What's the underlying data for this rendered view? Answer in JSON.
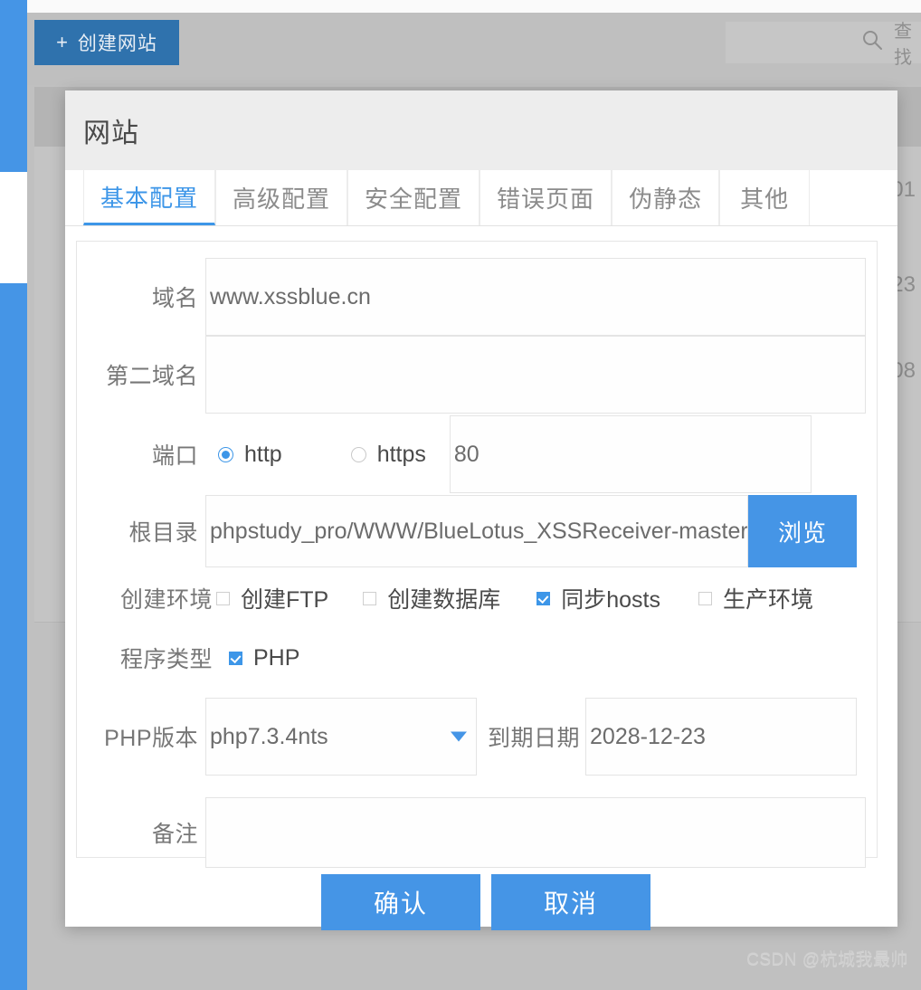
{
  "background": {
    "create_site_button": "创建网站",
    "create_site_plus": "+",
    "search_placeholder": "查找",
    "table_right_cells": [
      "01",
      "23",
      "08"
    ],
    "watermark": "CSDN @杭城我最帅"
  },
  "modal": {
    "title": "网站",
    "tabs": [
      {
        "label": "基本配置",
        "active": true
      },
      {
        "label": "高级配置",
        "active": false
      },
      {
        "label": "安全配置",
        "active": false
      },
      {
        "label": "错误页面",
        "active": false
      },
      {
        "label": "伪静态",
        "active": false
      },
      {
        "label": "其他",
        "active": false
      }
    ],
    "form": {
      "domain_label": "域名",
      "domain_value": "www.xssblue.cn",
      "second_domain_label": "第二域名",
      "second_domain_value": "",
      "port_label": "端口",
      "port_http_label": "http",
      "port_https_label": "https",
      "port_value": "80",
      "root_label": "根目录",
      "root_value": "phpstudy_pro/WWW/BlueLotus_XSSReceiver-master",
      "browse_label": "浏览",
      "env_label": "创建环境",
      "env_options": [
        {
          "label": "创建FTP",
          "checked": false
        },
        {
          "label": "创建数据库",
          "checked": false
        },
        {
          "label": "同步hosts",
          "checked": true
        },
        {
          "label": "生产环境",
          "checked": false
        }
      ],
      "program_type_label": "程序类型",
      "program_type_option": {
        "label": "PHP",
        "checked": true
      },
      "php_version_label": "PHP版本",
      "php_version_value": "php7.3.4nts",
      "expiry_label": "到期日期",
      "expiry_value": "2028-12-23",
      "remark_label": "备注",
      "remark_value": ""
    },
    "footer": {
      "confirm_label": "确认",
      "cancel_label": "取消"
    }
  },
  "colors": {
    "accent": "#4595e6",
    "tab_active": "#3d96e8",
    "rail": "#4595e6"
  }
}
